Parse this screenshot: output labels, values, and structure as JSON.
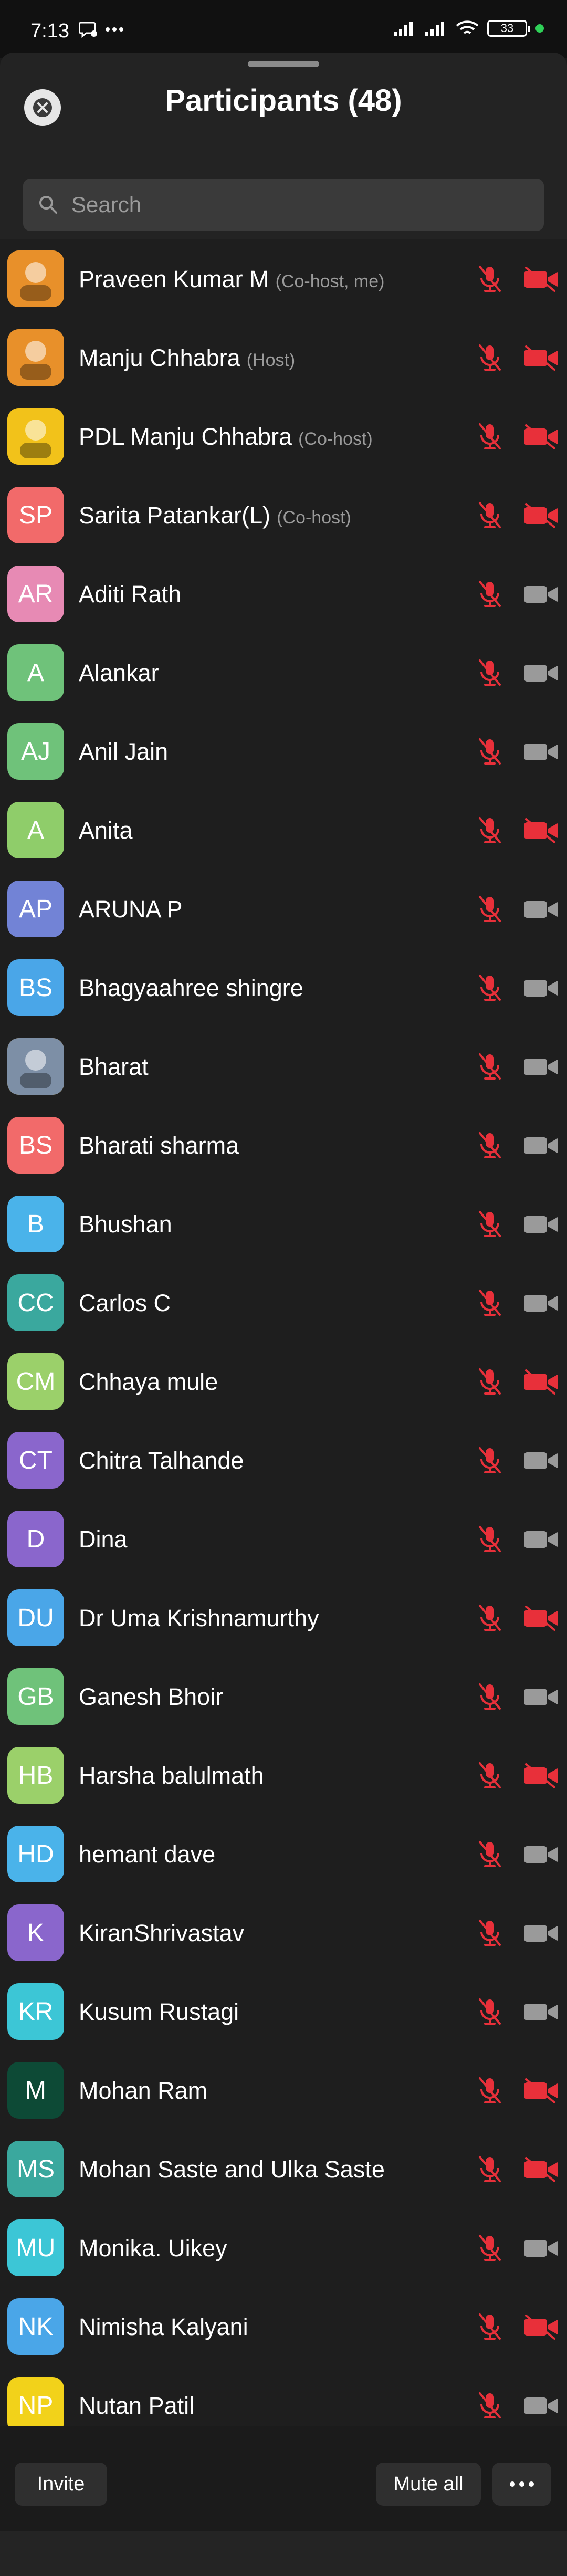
{
  "status_bar": {
    "time": "7:13",
    "left_icons": [
      "chat-bubble-icon",
      "more-dots-icon"
    ],
    "right_icons": [
      "signal-icon",
      "signal-icon",
      "wifi-icon"
    ],
    "battery": "33"
  },
  "header": {
    "title": "Participants (48)",
    "close_icon": "close-icon"
  },
  "search": {
    "placeholder": "Search",
    "value": ""
  },
  "colors": {
    "muted_red": "#e8303a",
    "cam_grey": "#9a9a9a"
  },
  "participants": [
    {
      "name": "Praveen Kumar M",
      "role": "(Co-host, me)",
      "initials": "",
      "avatar_color": "#e8902a",
      "avatar_type": "image",
      "video_off": true
    },
    {
      "name": "Manju Chhabra",
      "role": "(Host)",
      "initials": "",
      "avatar_color": "#e8902a",
      "avatar_type": "image",
      "video_off": true
    },
    {
      "name": "PDL Manju Chhabra",
      "role": "(Co-host)",
      "initials": "",
      "avatar_color": "#f2c21a",
      "avatar_type": "image",
      "video_off": true
    },
    {
      "name": "Sarita Patankar(L)",
      "role": "(Co-host)",
      "initials": "SP",
      "avatar_color": "#f26a6a",
      "avatar_type": "initials",
      "video_off": true
    },
    {
      "name": "Aditi Rath",
      "role": "",
      "initials": "AR",
      "avatar_color": "#e78ab4",
      "avatar_type": "initials",
      "video_off": false
    },
    {
      "name": "Alankar",
      "role": "",
      "initials": "A",
      "avatar_color": "#6fc27a",
      "avatar_type": "initials",
      "video_off": false
    },
    {
      "name": "Anil Jain",
      "role": "",
      "initials": "AJ",
      "avatar_color": "#6fc27a",
      "avatar_type": "initials",
      "video_off": false
    },
    {
      "name": "Anita",
      "role": "",
      "initials": "A",
      "avatar_color": "#8fcd6a",
      "avatar_type": "initials",
      "video_off": true
    },
    {
      "name": "ARUNA P",
      "role": "",
      "initials": "AP",
      "avatar_color": "#7283d6",
      "avatar_type": "initials",
      "video_off": false
    },
    {
      "name": "Bhagyaahree shingre",
      "role": "",
      "initials": "BS",
      "avatar_color": "#4aa6e8",
      "avatar_type": "initials",
      "video_off": false
    },
    {
      "name": "Bharat",
      "role": "",
      "initials": "",
      "avatar_color": "#7d8fa6",
      "avatar_type": "image",
      "video_off": false
    },
    {
      "name": "Bharati sharma",
      "role": "",
      "initials": "BS",
      "avatar_color": "#f26a6a",
      "avatar_type": "initials",
      "video_off": false
    },
    {
      "name": "Bhushan",
      "role": "",
      "initials": "B",
      "avatar_color": "#4ab3ea",
      "avatar_type": "initials",
      "video_off": false
    },
    {
      "name": "Carlos C",
      "role": "",
      "initials": "CC",
      "avatar_color": "#3aa89e",
      "avatar_type": "initials",
      "video_off": false
    },
    {
      "name": "Chhaya mule",
      "role": "",
      "initials": "CM",
      "avatar_color": "#9bd06a",
      "avatar_type": "initials",
      "video_off": true
    },
    {
      "name": "Chitra Talhande",
      "role": "",
      "initials": "CT",
      "avatar_color": "#8a66cc",
      "avatar_type": "initials",
      "video_off": false
    },
    {
      "name": "Dina",
      "role": "",
      "initials": "D",
      "avatar_color": "#8a66cc",
      "avatar_type": "initials",
      "video_off": false
    },
    {
      "name": "Dr Uma Krishnamurthy",
      "role": "",
      "initials": "DU",
      "avatar_color": "#4aa6e8",
      "avatar_type": "initials",
      "video_off": true
    },
    {
      "name": "Ganesh Bhoir",
      "role": "",
      "initials": "GB",
      "avatar_color": "#6fc27a",
      "avatar_type": "initials",
      "video_off": false
    },
    {
      "name": "Harsha balulmath",
      "role": "",
      "initials": "HB",
      "avatar_color": "#9bd06a",
      "avatar_type": "initials",
      "video_off": true
    },
    {
      "name": "hemant dave",
      "role": "",
      "initials": "HD",
      "avatar_color": "#4ab3ea",
      "avatar_type": "initials",
      "video_off": false
    },
    {
      "name": "KiranShrivastav",
      "role": "",
      "initials": "K",
      "avatar_color": "#8a66cc",
      "avatar_type": "initials",
      "video_off": false
    },
    {
      "name": "Kusum Rustagi",
      "role": "",
      "initials": "KR",
      "avatar_color": "#3cc6d6",
      "avatar_type": "initials",
      "video_off": false
    },
    {
      "name": "Mohan Ram",
      "role": "",
      "initials": "M",
      "avatar_color": "#0d4a36",
      "avatar_type": "initials",
      "video_off": true
    },
    {
      "name": "Mohan Saste and Ulka Saste",
      "role": "",
      "initials": "MS",
      "avatar_color": "#3aa89e",
      "avatar_type": "initials",
      "video_off": true
    },
    {
      "name": "Monika. Uikey",
      "role": "",
      "initials": "MU",
      "avatar_color": "#3cc6d6",
      "avatar_type": "initials",
      "video_off": false
    },
    {
      "name": "Nimisha Kalyani",
      "role": "",
      "initials": "NK",
      "avatar_color": "#4aa6e8",
      "avatar_type": "initials",
      "video_off": true
    },
    {
      "name": "Nutan Patil",
      "role": "",
      "initials": "NP",
      "avatar_color": "#f2d21a",
      "avatar_type": "initials",
      "video_off": false
    }
  ],
  "footer": {
    "invite_label": "Invite",
    "mute_all_label": "Mute all",
    "more_icon": "more-options-icon"
  }
}
